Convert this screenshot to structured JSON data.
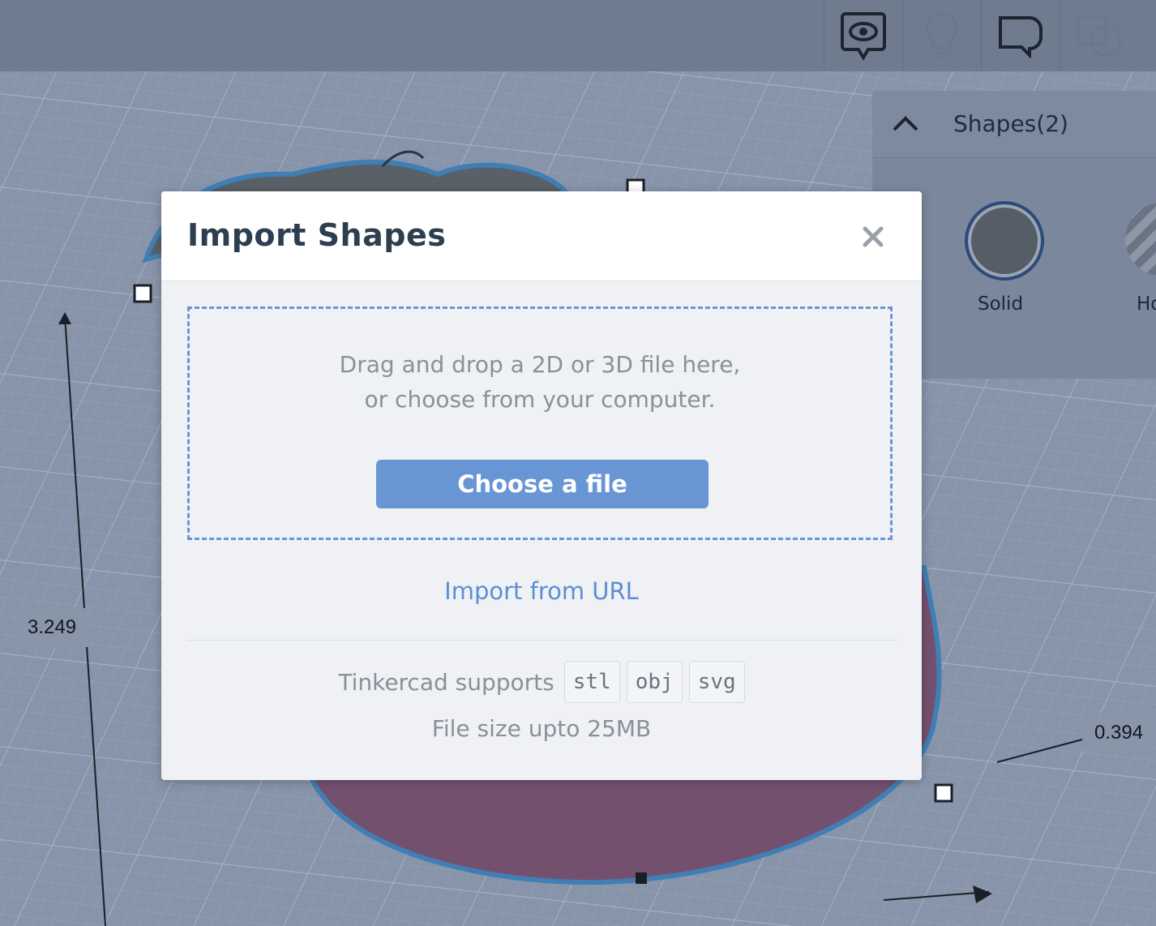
{
  "toolbar": {
    "icons": [
      "view-comment-icon",
      "lightbulb-icon",
      "note-shape-icon",
      "copy-shape-icon"
    ]
  },
  "shapes_panel": {
    "title": "Shapes(2)",
    "solid_label": "Solid",
    "hole_label": "Ho"
  },
  "dimensions": {
    "left": "3.249",
    "right": "0.394"
  },
  "modal": {
    "title": "Import Shapes",
    "drop_line1": "Drag and drop a 2D or 3D file here,",
    "drop_line2": "or choose from your computer.",
    "choose_file": "Choose a file",
    "import_url": "Import from URL",
    "supports_text": "Tinkercad supports",
    "formats": [
      "stl",
      "obj",
      "svg"
    ],
    "file_size": "File size upto 25MB"
  },
  "colors": {
    "accent": "#6895d3",
    "link": "#5b8fd4",
    "overlay": "#8a96ab"
  }
}
